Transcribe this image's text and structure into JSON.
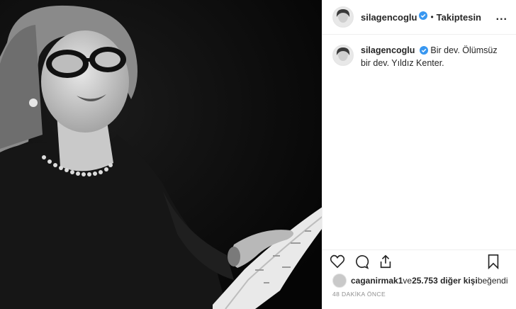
{
  "post": {
    "image_alt": "Black and white portrait of a woman with glasses holding a script",
    "username": "silagencoglu",
    "follow_label": "Takiptesin",
    "dot": "•",
    "more": "...",
    "caption_user": "silagencoglu",
    "caption_text": "Bir dev. Ölümsüz bir dev. Yıldız Kenter.",
    "likes_user": "caganirmak1",
    "likes_middle": " ve ",
    "likes_count": "25.753 diğer kişi",
    "likes_suffix": " beğendi",
    "timestamp": "48 DAKİKA ÖNCE"
  },
  "icons": {
    "verified": "verified-badge-icon",
    "like": "heart-icon",
    "comment": "comment-icon",
    "share": "share-icon",
    "save": "bookmark-icon"
  },
  "colors": {
    "verified": "#3897f0",
    "text": "#262626",
    "muted": "#8e8e8e"
  }
}
